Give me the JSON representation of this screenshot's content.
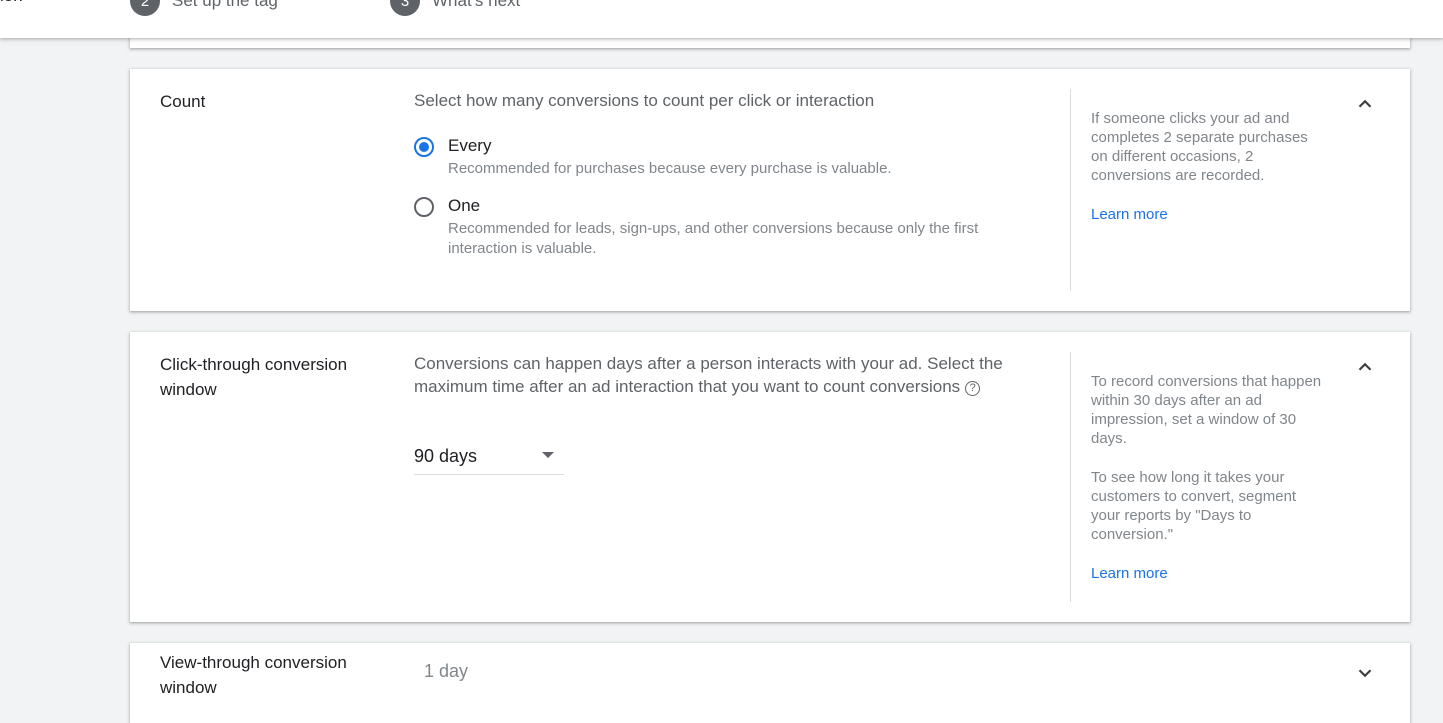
{
  "stepper": {
    "prev_label": "ion",
    "steps": [
      {
        "num": "2",
        "label": "Set up the tag"
      },
      {
        "num": "3",
        "label": "What's next"
      }
    ]
  },
  "count": {
    "title": "Count",
    "question": "Select how many conversions to count per click or interaction",
    "options": [
      {
        "label": "Every",
        "desc": "Recommended for purchases because every purchase is valuable.",
        "selected": true
      },
      {
        "label": "One",
        "desc": "Recommended for leads, sign-ups, and other conversions because only the first interaction is valuable.",
        "selected": false
      }
    ],
    "help": "If someone clicks your ad and completes 2 separate purchases on different occasions, 2 conversions are recorded.",
    "learn_more": "Learn more"
  },
  "click_through": {
    "title": "Click-through conversion window",
    "question": "Conversions can happen days after a person interacts with your ad. Select the maximum time after an ad interaction that you want to count conversions",
    "selected_value": "90 days",
    "help_1": "To record conversions that happen within 30 days after an ad impression, set a window of 30 days.",
    "help_2": "To see how long it takes your customers to convert, segment your reports by \"Days to conversion.\"",
    "learn_more": "Learn more"
  },
  "view_through": {
    "title": "View-through conversion window",
    "value": "1 day"
  },
  "colors": {
    "accent": "#1a73e8",
    "background": "#f1f3f4"
  },
  "icons": {
    "collapse": "chevron-up-icon",
    "expand": "chevron-down-icon",
    "dropdown": "dropdown-arrow-icon",
    "help": "help-circle-icon"
  }
}
